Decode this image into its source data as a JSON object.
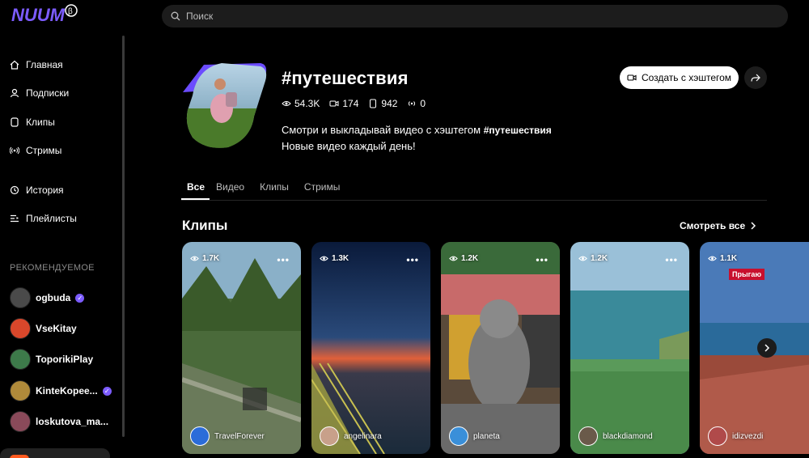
{
  "brand": {
    "logo_text": "NUUM",
    "beta_mark": "β"
  },
  "search": {
    "placeholder": "Поиск"
  },
  "sidebar": {
    "nav": [
      {
        "label": "Главная",
        "icon": "home-icon"
      },
      {
        "label": "Подписки",
        "icon": "user-icon"
      },
      {
        "label": "Клипы",
        "icon": "clips-icon"
      },
      {
        "label": "Стримы",
        "icon": "broadcast-icon"
      },
      {
        "label": "История",
        "icon": "history-icon"
      },
      {
        "label": "Плейлисты",
        "icon": "playlist-icon"
      }
    ],
    "recommended_title": "РЕКОМЕНДУЕМОЕ",
    "recommended": [
      {
        "name": "ogbuda",
        "verified": true,
        "color": "#4a4a4a"
      },
      {
        "name": "VseKitay",
        "verified": false,
        "color": "#d9472b"
      },
      {
        "name": "ToporikiPlay",
        "verified": false,
        "color": "#3d7a4a"
      },
      {
        "name": "KinteKopee...",
        "verified": true,
        "color": "#b08a3a"
      },
      {
        "name": "loskutova_ma...",
        "verified": false,
        "color": "#8a4a5a"
      }
    ]
  },
  "hashtag": {
    "title": "#путешествия",
    "stats": {
      "views": "54.3K",
      "videos": "174",
      "clips": "942",
      "streams": "0"
    },
    "description_line1": "Смотри и выкладывай видео с хэштегом",
    "description_tag": "#путешествия",
    "description_line2": "Новые видео каждый день!",
    "create_button": "Создать с хэштегом"
  },
  "tabs": [
    "Все",
    "Видео",
    "Клипы",
    "Стримы"
  ],
  "clips_section": {
    "title": "Клипы",
    "see_all": "Смотреть все",
    "clips": [
      {
        "views": "1.7K",
        "author": "TravelForever",
        "theme": "park",
        "avatar_color": "#2b6cd9"
      },
      {
        "views": "1.3K",
        "author": "angelinara",
        "theme": "sunset",
        "avatar_color": "#c8a08a"
      },
      {
        "views": "1.2K",
        "author": "planeta",
        "theme": "mall",
        "avatar_color": "#3a8fd9"
      },
      {
        "views": "1.2K",
        "author": "blackdiamond",
        "theme": "sea",
        "avatar_color": "#6a5a4a"
      },
      {
        "views": "1.1K",
        "author": "idizvezdi",
        "theme": "coast",
        "avatar_color": "#b04a4a",
        "overlay": "Прыгаю"
      }
    ]
  },
  "colors": {
    "accent": "#7c5cff",
    "background": "#000000",
    "surface": "#1c1c1c"
  }
}
